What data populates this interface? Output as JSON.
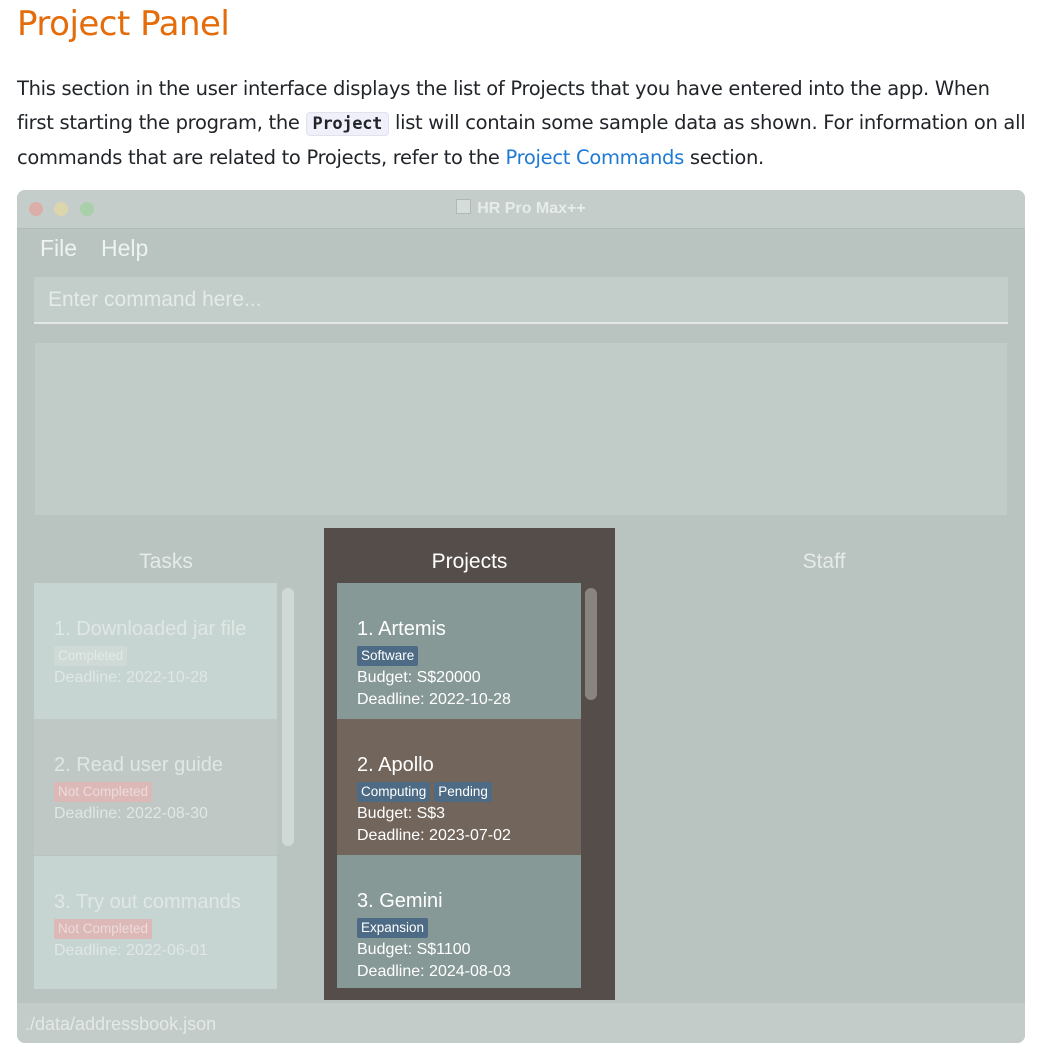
{
  "doc": {
    "title": "Project Panel",
    "para_part1": "This section in the user interface displays the list of Projects that you have entered into the app. When first starting the program, the ",
    "para_code": "Project",
    "para_part2": " list will contain some sample data as shown. For information on all commands that are related to Projects, refer to the ",
    "para_link": "Project Commands",
    "para_part3": " section."
  },
  "app": {
    "window_title": "HR Pro Max++",
    "menu": {
      "file": "File",
      "help": "Help"
    },
    "command_placeholder": "Enter command here...",
    "tasks": {
      "title": "Tasks",
      "items": [
        {
          "name": "1.  Downloaded jar file",
          "status": "Completed",
          "deadline": "Deadline: 2022-10-28"
        },
        {
          "name": "2.  Read user guide",
          "status": "Not Completed",
          "deadline": "Deadline: 2022-08-30"
        },
        {
          "name": "3.  Try out commands",
          "status": "Not Completed",
          "deadline": "Deadline: 2022-06-01"
        }
      ]
    },
    "projects": {
      "title": "Projects",
      "items": [
        {
          "name": "1.  Artemis",
          "tags": [
            "Software"
          ],
          "budget": "Budget: S$20000",
          "deadline": "Deadline: 2022-10-28"
        },
        {
          "name": "2.  Apollo",
          "tags": [
            "Computing",
            "Pending"
          ],
          "budget": "Budget: S$3",
          "deadline": "Deadline: 2023-07-02"
        },
        {
          "name": "3.  Gemini",
          "tags": [
            "Expansion"
          ],
          "budget": "Budget: S$1100",
          "deadline": "Deadline: 2024-08-03"
        }
      ]
    },
    "staff": {
      "title": "Staff"
    },
    "status_path": "./data/addressbook.json"
  },
  "colors": {
    "doc_title": "#e46c0a",
    "link": "#1e7ad4",
    "projects_panel": "#544d49",
    "project_card": "#879997",
    "project_card_selected": "#72655b",
    "tag": "#4d6b84"
  }
}
